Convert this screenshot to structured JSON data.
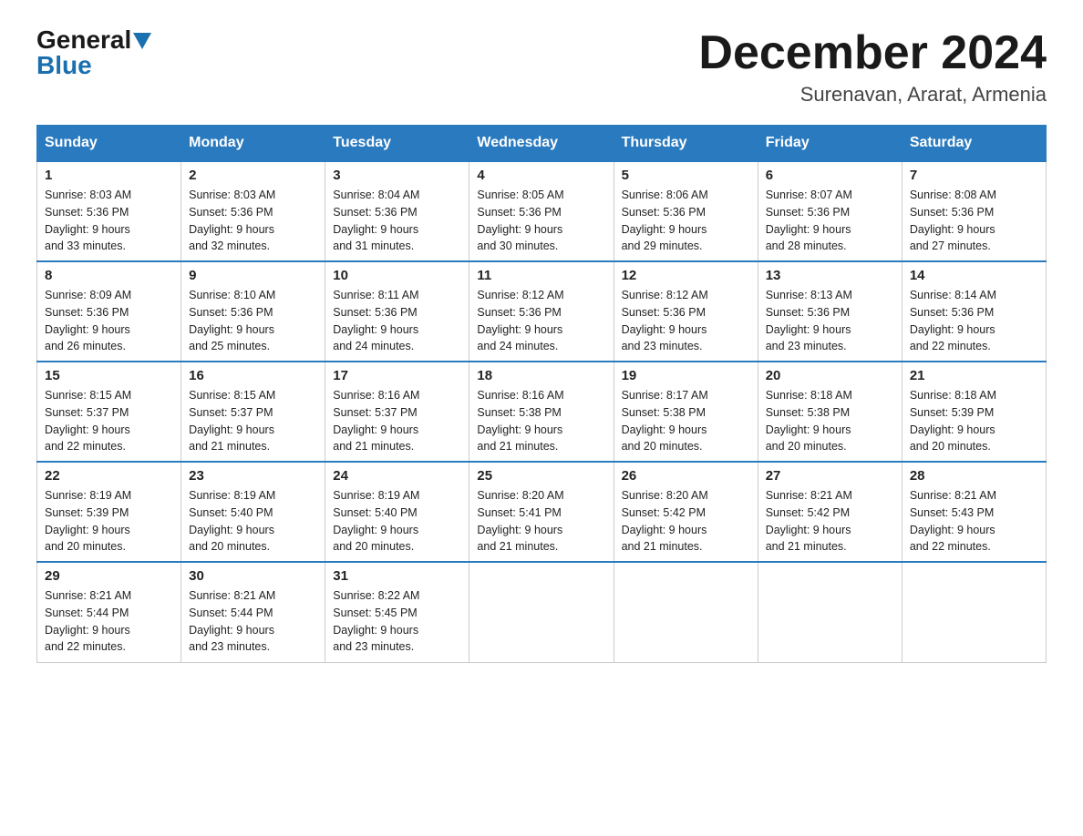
{
  "header": {
    "logo_line1": "General",
    "logo_line2": "Blue",
    "month_title": "December 2024",
    "location": "Surenavan, Ararat, Armenia"
  },
  "days_of_week": [
    "Sunday",
    "Monday",
    "Tuesday",
    "Wednesday",
    "Thursday",
    "Friday",
    "Saturday"
  ],
  "weeks": [
    [
      {
        "day": "1",
        "sunrise": "8:03 AM",
        "sunset": "5:36 PM",
        "daylight": "9 hours and 33 minutes."
      },
      {
        "day": "2",
        "sunrise": "8:03 AM",
        "sunset": "5:36 PM",
        "daylight": "9 hours and 32 minutes."
      },
      {
        "day": "3",
        "sunrise": "8:04 AM",
        "sunset": "5:36 PM",
        "daylight": "9 hours and 31 minutes."
      },
      {
        "day": "4",
        "sunrise": "8:05 AM",
        "sunset": "5:36 PM",
        "daylight": "9 hours and 30 minutes."
      },
      {
        "day": "5",
        "sunrise": "8:06 AM",
        "sunset": "5:36 PM",
        "daylight": "9 hours and 29 minutes."
      },
      {
        "day": "6",
        "sunrise": "8:07 AM",
        "sunset": "5:36 PM",
        "daylight": "9 hours and 28 minutes."
      },
      {
        "day": "7",
        "sunrise": "8:08 AM",
        "sunset": "5:36 PM",
        "daylight": "9 hours and 27 minutes."
      }
    ],
    [
      {
        "day": "8",
        "sunrise": "8:09 AM",
        "sunset": "5:36 PM",
        "daylight": "9 hours and 26 minutes."
      },
      {
        "day": "9",
        "sunrise": "8:10 AM",
        "sunset": "5:36 PM",
        "daylight": "9 hours and 25 minutes."
      },
      {
        "day": "10",
        "sunrise": "8:11 AM",
        "sunset": "5:36 PM",
        "daylight": "9 hours and 24 minutes."
      },
      {
        "day": "11",
        "sunrise": "8:12 AM",
        "sunset": "5:36 PM",
        "daylight": "9 hours and 24 minutes."
      },
      {
        "day": "12",
        "sunrise": "8:12 AM",
        "sunset": "5:36 PM",
        "daylight": "9 hours and 23 minutes."
      },
      {
        "day": "13",
        "sunrise": "8:13 AM",
        "sunset": "5:36 PM",
        "daylight": "9 hours and 23 minutes."
      },
      {
        "day": "14",
        "sunrise": "8:14 AM",
        "sunset": "5:36 PM",
        "daylight": "9 hours and 22 minutes."
      }
    ],
    [
      {
        "day": "15",
        "sunrise": "8:15 AM",
        "sunset": "5:37 PM",
        "daylight": "9 hours and 22 minutes."
      },
      {
        "day": "16",
        "sunrise": "8:15 AM",
        "sunset": "5:37 PM",
        "daylight": "9 hours and 21 minutes."
      },
      {
        "day": "17",
        "sunrise": "8:16 AM",
        "sunset": "5:37 PM",
        "daylight": "9 hours and 21 minutes."
      },
      {
        "day": "18",
        "sunrise": "8:16 AM",
        "sunset": "5:38 PM",
        "daylight": "9 hours and 21 minutes."
      },
      {
        "day": "19",
        "sunrise": "8:17 AM",
        "sunset": "5:38 PM",
        "daylight": "9 hours and 20 minutes."
      },
      {
        "day": "20",
        "sunrise": "8:18 AM",
        "sunset": "5:38 PM",
        "daylight": "9 hours and 20 minutes."
      },
      {
        "day": "21",
        "sunrise": "8:18 AM",
        "sunset": "5:39 PM",
        "daylight": "9 hours and 20 minutes."
      }
    ],
    [
      {
        "day": "22",
        "sunrise": "8:19 AM",
        "sunset": "5:39 PM",
        "daylight": "9 hours and 20 minutes."
      },
      {
        "day": "23",
        "sunrise": "8:19 AM",
        "sunset": "5:40 PM",
        "daylight": "9 hours and 20 minutes."
      },
      {
        "day": "24",
        "sunrise": "8:19 AM",
        "sunset": "5:40 PM",
        "daylight": "9 hours and 20 minutes."
      },
      {
        "day": "25",
        "sunrise": "8:20 AM",
        "sunset": "5:41 PM",
        "daylight": "9 hours and 21 minutes."
      },
      {
        "day": "26",
        "sunrise": "8:20 AM",
        "sunset": "5:42 PM",
        "daylight": "9 hours and 21 minutes."
      },
      {
        "day": "27",
        "sunrise": "8:21 AM",
        "sunset": "5:42 PM",
        "daylight": "9 hours and 21 minutes."
      },
      {
        "day": "28",
        "sunrise": "8:21 AM",
        "sunset": "5:43 PM",
        "daylight": "9 hours and 22 minutes."
      }
    ],
    [
      {
        "day": "29",
        "sunrise": "8:21 AM",
        "sunset": "5:44 PM",
        "daylight": "9 hours and 22 minutes."
      },
      {
        "day": "30",
        "sunrise": "8:21 AM",
        "sunset": "5:44 PM",
        "daylight": "9 hours and 23 minutes."
      },
      {
        "day": "31",
        "sunrise": "8:22 AM",
        "sunset": "5:45 PM",
        "daylight": "9 hours and 23 minutes."
      },
      null,
      null,
      null,
      null
    ]
  ]
}
